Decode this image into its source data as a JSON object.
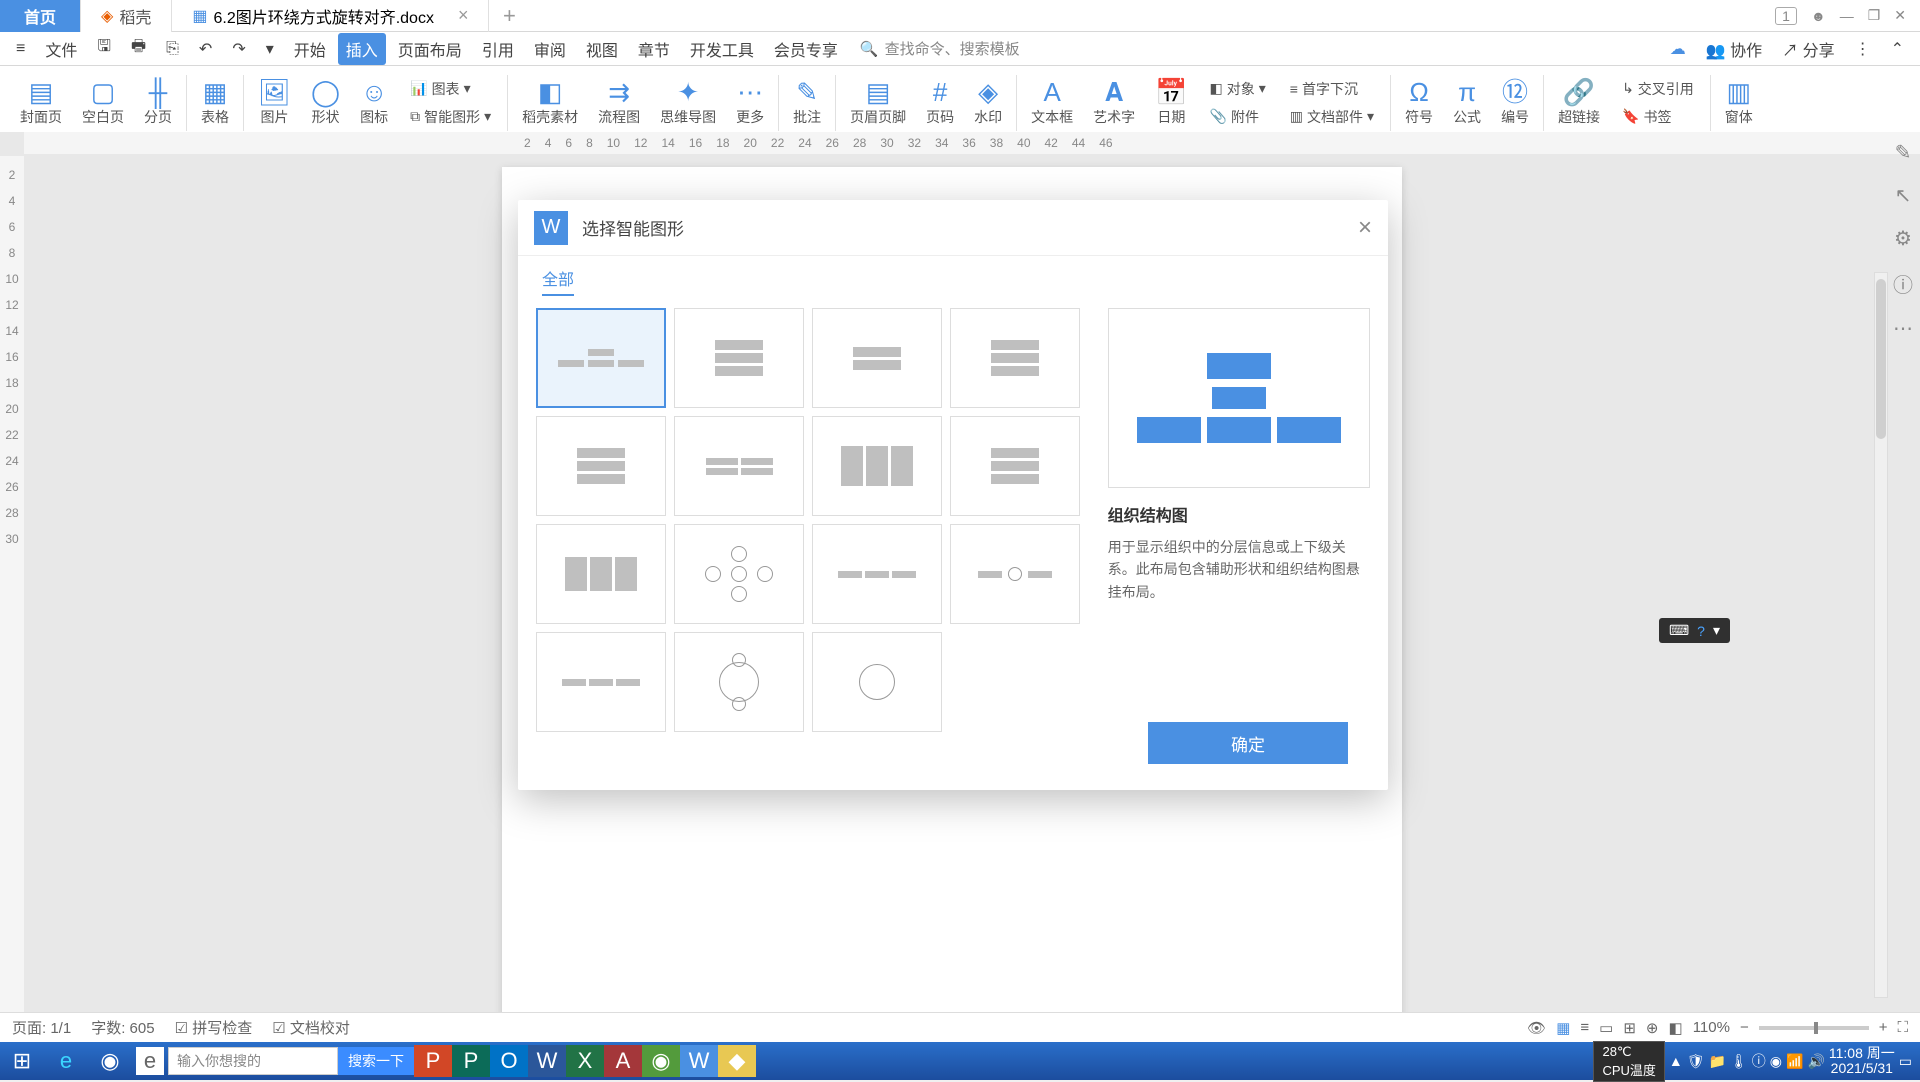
{
  "tabs": {
    "home": "首页",
    "docker": "稻壳",
    "doc": "6.2图片环绕方式旋转对齐.docx"
  },
  "winbadge": "1",
  "menu": {
    "file": "文件",
    "items": [
      "开始",
      "插入",
      "页面布局",
      "引用",
      "审阅",
      "视图",
      "章节",
      "开发工具",
      "会员专享"
    ],
    "active": "插入",
    "search_ph": "查找命令、搜索模板",
    "collab": "协作",
    "share": "分享"
  },
  "ribbon": {
    "cover": "封面页",
    "blank": "空白页",
    "pagebreak": "分页",
    "table": "表格",
    "pic": "图片",
    "shape": "形状",
    "icon": "图标",
    "chart": "图表",
    "smart": "智能图形",
    "dockermat": "稻壳素材",
    "flow": "流程图",
    "mind": "思维导图",
    "more": "更多",
    "comment": "批注",
    "headfoot": "页眉页脚",
    "pageno": "页码",
    "watermark": "水印",
    "textbox": "文本框",
    "artword": "艺术字",
    "date": "日期",
    "object": "对象",
    "firstdrop": "首字下沉",
    "attach": "附件",
    "docpart": "文档部件",
    "symbol": "符号",
    "formula": "公式",
    "number": "编号",
    "link": "超链接",
    "xref": "交叉引用",
    "bookmark": "书签",
    "kit": "窗体"
  },
  "modal": {
    "title": "选择智能图形",
    "tab": "全部",
    "sel_name": "组织结构图",
    "sel_desc": "用于显示组织中的分层信息或上下级关系。此布局包含辅助形状和组织结构图悬挂布局。",
    "ok": "确定"
  },
  "status": {
    "page": "页面: 1/1",
    "words": "字数: 605",
    "spell": "拼写检查",
    "doccheck": "文档校对",
    "zoom": "110%"
  },
  "task": {
    "search_ph": "输入你想搜的",
    "search_btn": "搜索一下",
    "temp": "28℃",
    "cpu": "CPU温度",
    "time": "11:08",
    "day": "周一",
    "date": "2021/5/31"
  },
  "floaty": {
    "help": "?"
  }
}
